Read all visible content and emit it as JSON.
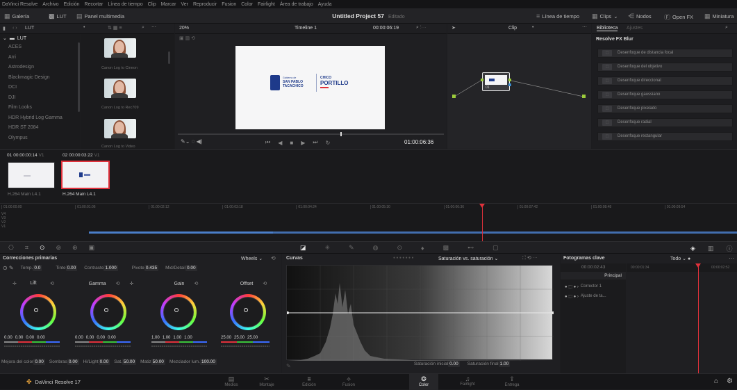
{
  "menubar": [
    "DaVinci Resolve",
    "Archivo",
    "Edición",
    "Recortar",
    "Línea de tiempo",
    "Clip",
    "Marcar",
    "Ver",
    "Reproducir",
    "Fusion",
    "Color",
    "Fairlight",
    "Área de trabajo",
    "Ayuda"
  ],
  "topbar": {
    "gallery": "Galería",
    "lut": "LUT",
    "media_panel": "Panel multimedia",
    "project_title": "Untitled Project 57",
    "project_status": "Editado",
    "timeline_btn": "Línea de tiempo",
    "clips_btn": "Clips",
    "nodes_btn": "Nodos",
    "openfx_btn": "Open FX",
    "thumbs_btn": "Miniatura"
  },
  "subbar": {
    "lut_path": "LUT",
    "zoom": "20%",
    "timeline_name": "Timeline 1",
    "timecode": "00:00:06:19",
    "clip_dropdown": "Clip",
    "library_tab": "Biblioteca",
    "adjust_tab": "Ajustes"
  },
  "lut_tree": {
    "root": "LUT",
    "items": [
      "ACES",
      "Arri",
      "Astrodesign",
      "Blackmagic Design",
      "DCI",
      "DJI",
      "Film Looks",
      "HDR Hybrid Log Gamma",
      "HDR ST 2084",
      "Olympus"
    ]
  },
  "lut_thumbs": [
    "Canon Log to Cineon",
    "Canon Log to Rec709",
    "Canon Log to Video"
  ],
  "viewer": {
    "logo1_small": "Gobierno de",
    "logo1_main": "SAN PABLO",
    "logo1_sub": "TACACHICO",
    "logo2_top": "CHICO",
    "logo2_main": "PORTILLO",
    "timecode": "01:00:06:36"
  },
  "node": {
    "label": "01"
  },
  "fx": {
    "header": "Resolve FX Blur",
    "items": [
      "Desenfoque de distancia focal",
      "Desenfoque del objetivo",
      "Desenfoque direccional",
      "Desenfoque gaussiano",
      "Desenfoque pixelado",
      "Desenfoque radial",
      "Desenfoque rectangular"
    ]
  },
  "clips": [
    {
      "num": "01",
      "tc": "00:00:00:14",
      "track": "V1",
      "codec": "H.264 Main L4.1"
    },
    {
      "num": "02",
      "tc": "00:00:03:22",
      "track": "V1",
      "codec": "H.264 Main L4.1"
    }
  ],
  "timeline": {
    "ticks": [
      "01:00:00:00",
      "01:00:01:06",
      "01:00:02:12",
      "01:00:03:18",
      "01:00:04:24",
      "01:00:05:30",
      "01:00:06:36",
      "01:00:07:42",
      "01:00:08:48",
      "01:00:09:54"
    ],
    "tracks": [
      "V4",
      "V3",
      "V2",
      "V1"
    ]
  },
  "primary": {
    "title": "Correcciones primarias",
    "mode": "Wheels",
    "temp_label": "Temp.",
    "temp": "0.0",
    "tint_label": "Tinte",
    "tint": "0.00",
    "contrast_label": "Contraste",
    "contrast": "1.000",
    "pivot_label": "Pivote",
    "pivot": "0.435",
    "middetail_label": "Mid/Detail",
    "middetail": "0.00",
    "wheels": [
      {
        "name": "Lift",
        "vals": [
          "0.00",
          "0.00",
          "0.00",
          "0.00"
        ]
      },
      {
        "name": "Gamma",
        "vals": [
          "0.00",
          "0.00",
          "0.00",
          "0.00"
        ]
      },
      {
        "name": "Gain",
        "vals": [
          "1.00",
          "1.00",
          "1.00",
          "1.00"
        ]
      },
      {
        "name": "Offset",
        "vals": [
          "25.00",
          "25.00",
          "25.00"
        ]
      }
    ],
    "bottom": {
      "color_boost_label": "Mejora del color",
      "color_boost": "0.00",
      "shadows_label": "Sombras",
      "shadows": "0.00",
      "hilight_label": "Hi/Light",
      "hilight": "0.00",
      "sat_label": "Sat.",
      "sat": "50.00",
      "hue_label": "Matiz",
      "hue": "50.00",
      "lummix_label": "Mezclador lum.",
      "lummix": "100.00"
    }
  },
  "curves": {
    "title": "Curvas",
    "mode": "Saturación vs. saturación",
    "input_sat_label": "Saturación inicial",
    "input_sat": "0.00",
    "output_sat_label": "Saturación final",
    "output_sat": "1.00"
  },
  "keyframes": {
    "title": "Fotogramas clave",
    "filter": "Todo",
    "tc": "00:00:02:43",
    "tc_ruler_start": "00:00:01:34",
    "tc_ruler_end": "00:00:02:52",
    "main": "Principal",
    "rows": [
      "Corrector 1",
      "Ajuste de ta..."
    ]
  },
  "bottomnav": {
    "app": "DaVinci Resolve 17",
    "tabs": [
      "Medios",
      "Montaje",
      "Edición",
      "Fusion",
      "Color",
      "Fairlight",
      "Entrega"
    ],
    "active": "Color"
  },
  "colors": {
    "accent": "#e0313b",
    "blue_track": "#4a7ec9",
    "bg": "#1c1c1f"
  }
}
